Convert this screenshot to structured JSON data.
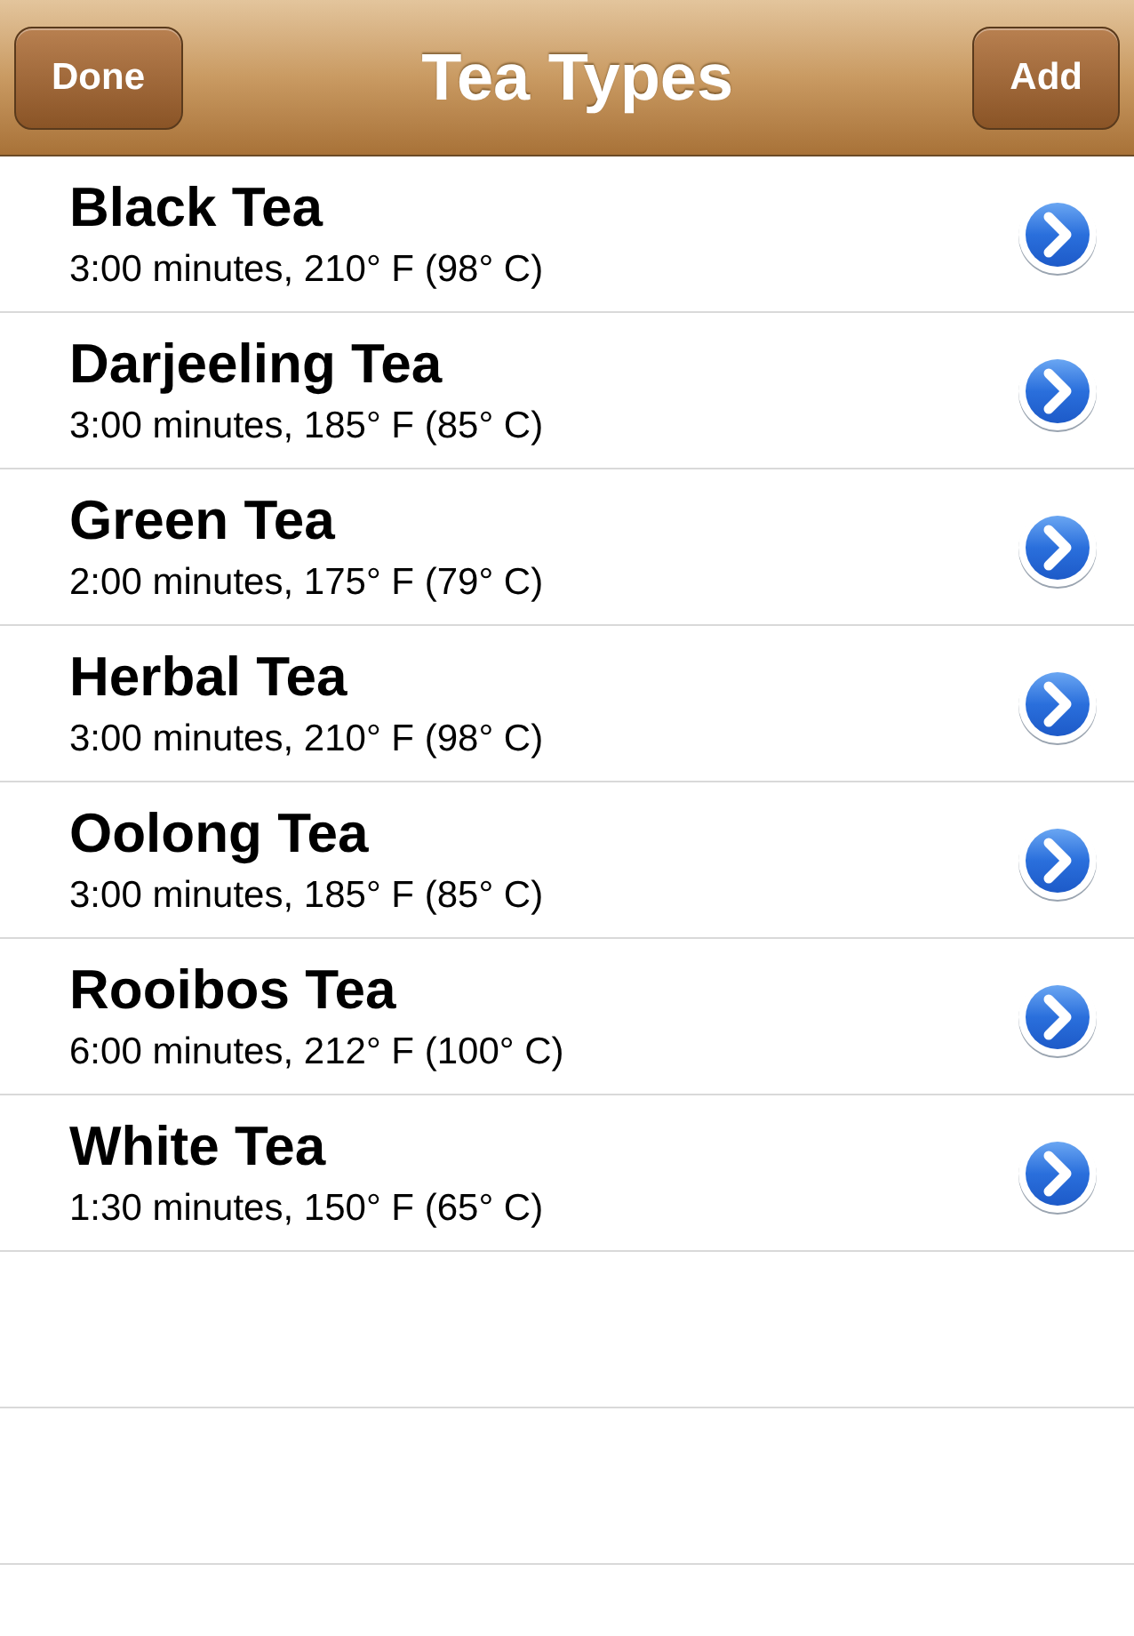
{
  "nav_bar": {
    "left_button": "Done",
    "title": "Tea Types",
    "right_button": "Add"
  },
  "rows": [
    {
      "name": "Black Tea",
      "detail": "3:00 minutes, 210° F (98° C)"
    },
    {
      "name": "Darjeeling Tea",
      "detail": "3:00 minutes, 185° F (85° C)"
    },
    {
      "name": "Green Tea",
      "detail": "2:00 minutes, 175° F (79° C)"
    },
    {
      "name": "Herbal Tea",
      "detail": "3:00 minutes, 210° F (98° C)"
    },
    {
      "name": "Oolong Tea",
      "detail": "3:00 minutes, 185° F (85° C)"
    },
    {
      "name": "Rooibos Tea",
      "detail": "6:00 minutes, 212° F (100° C)"
    },
    {
      "name": "White Tea",
      "detail": "1:30 minutes, 150° F (65° C)"
    }
  ]
}
